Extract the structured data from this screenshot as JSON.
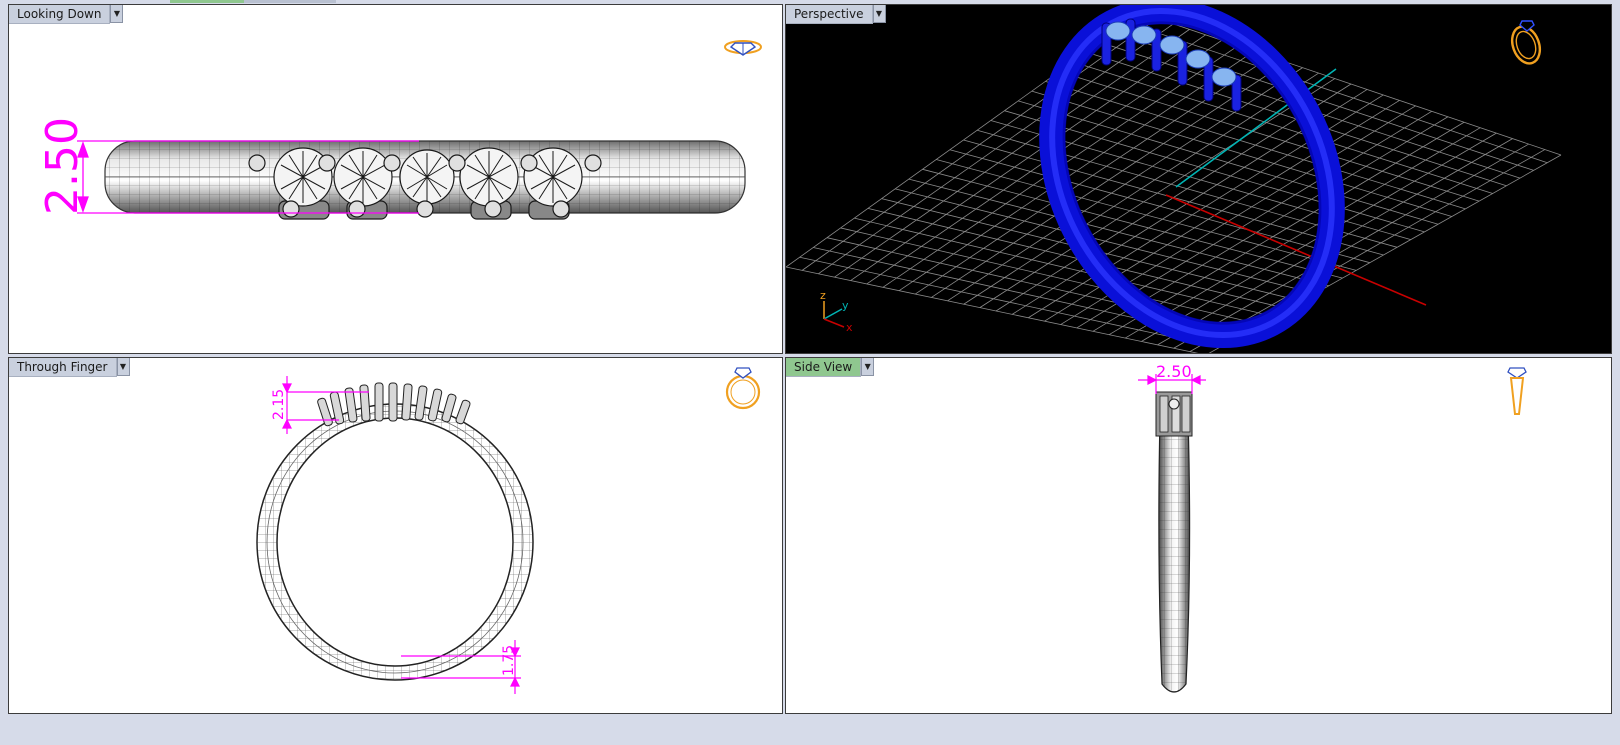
{
  "viewports": {
    "top_left": {
      "title": "Looking Down",
      "dimension": "2.50"
    },
    "top_right": {
      "title": "Perspective",
      "axis_labels": {
        "z": "z",
        "y": "y",
        "x": "x"
      }
    },
    "bottom_left": {
      "title": "Through Finger",
      "dimension_top": "2.15",
      "dimension_bottom": "1.75"
    },
    "bottom_right": {
      "title": "Side View",
      "dimension": "2.50"
    }
  },
  "colors": {
    "dimension": "#ff00ff",
    "ring_perspective": "#0a10d8",
    "grid": "#8a8a8a",
    "axis_x": "#c80000",
    "axis_y": "#00b4b4",
    "active_tab": "#8fc78f"
  },
  "icons": [
    "dropdown-arrow-icon",
    "view-orientation-icon",
    "diamond-icon",
    "ring-icon"
  ]
}
